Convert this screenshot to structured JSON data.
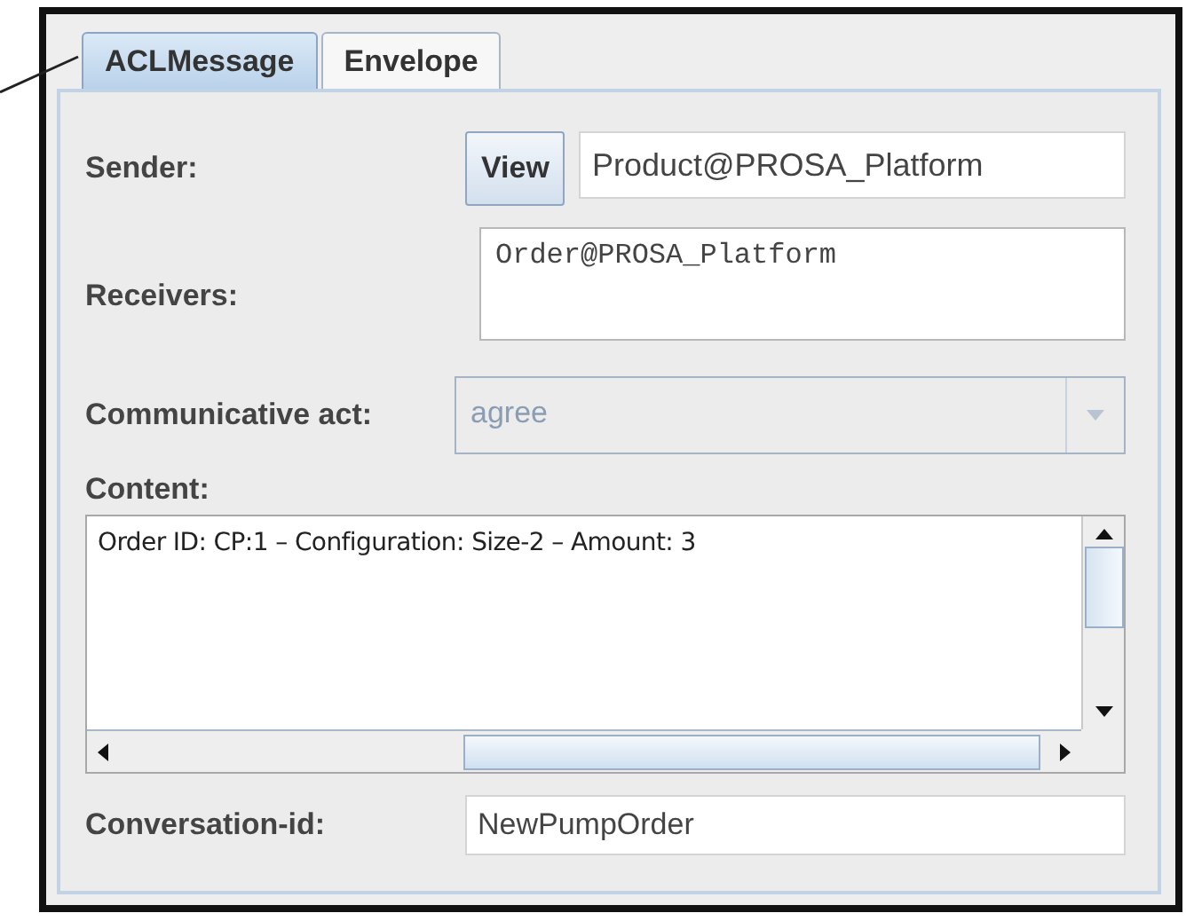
{
  "tabs": [
    {
      "label": "ACLMessage",
      "selected": true
    },
    {
      "label": "Envelope",
      "selected": false
    }
  ],
  "sender": {
    "label": "Sender:",
    "button": "View",
    "value": "Product@PROSA_Platform"
  },
  "receivers": {
    "label": "Receivers:",
    "value": "Order@PROSA_Platform"
  },
  "communicative_act": {
    "label": "Communicative act:",
    "value": "agree",
    "disabled": true
  },
  "content": {
    "label": "Content:",
    "value": "Order ID: CP:1 – Configuration: Size-2 – Amount: 3"
  },
  "conversation_id": {
    "label": "Conversation-id:",
    "value": "NewPumpOrder"
  }
}
